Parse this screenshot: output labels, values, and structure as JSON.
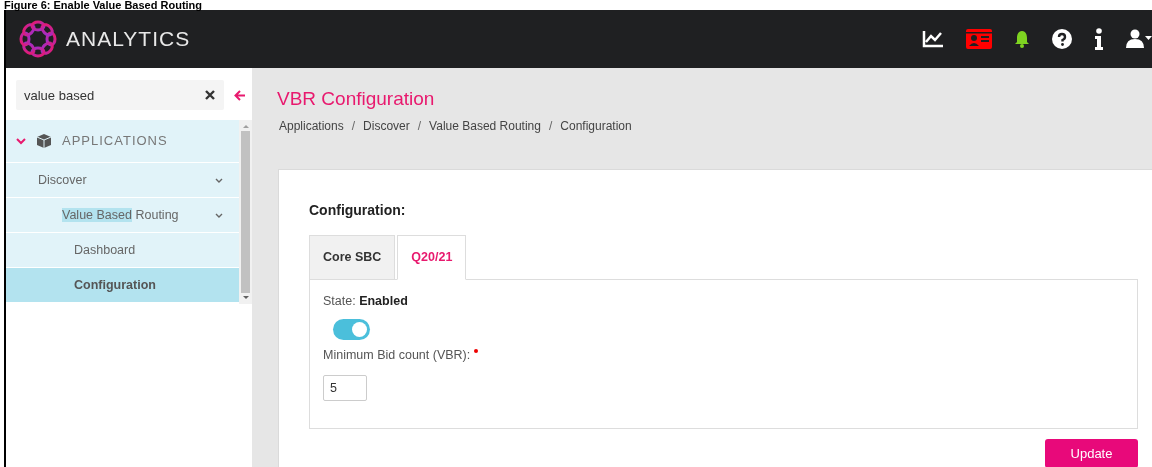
{
  "caption": "Figure 6: Enable Value Based Routing",
  "header": {
    "brand": "ANALYTICS",
    "icons": [
      {
        "kind": "chart"
      },
      {
        "kind": "card",
        "color": "#ff0000"
      },
      {
        "kind": "bell",
        "color": "#7ed321"
      },
      {
        "kind": "help"
      },
      {
        "kind": "info"
      },
      {
        "kind": "user"
      }
    ]
  },
  "sidebar": {
    "search": {
      "value": "value based"
    },
    "items": [
      {
        "label": "APPLICATIONS",
        "expanded": true,
        "selected": false,
        "children": [
          {
            "label": "Discover",
            "expanded": true,
            "selected": false,
            "children": [
              {
                "highlight": "Value Based",
                "label": "Routing",
                "expanded": true,
                "selected": false,
                "children": [
                  {
                    "label": "Dashboard",
                    "selected": false
                  },
                  {
                    "label": "Configuration",
                    "selected": true
                  }
                ]
              }
            ]
          }
        ]
      }
    ]
  },
  "page": {
    "title": "VBR Configuration",
    "breadcrumb": [
      "Applications",
      "Discover",
      "Value Based Routing",
      "Configuration"
    ],
    "breadcrumb_separator": "/",
    "section": "Configuration:",
    "tabs": [
      {
        "label": "Core SBC",
        "selected": false
      },
      {
        "label": "Q20/21",
        "selected": true
      }
    ],
    "state_label": "State:",
    "state_value": "Enabled",
    "state_on": true,
    "field_label": "Minimum Bid count (VBR):",
    "required": true,
    "field_value": "5",
    "button": "Update"
  }
}
